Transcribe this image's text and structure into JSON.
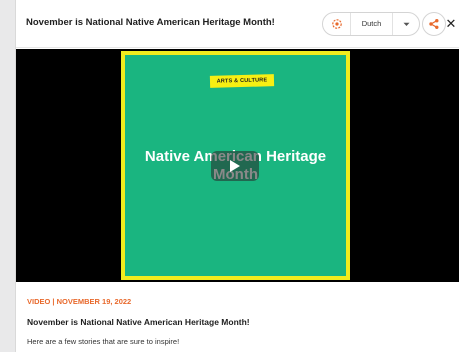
{
  "header": {
    "title": "November is National Native American Heritage Month!",
    "language": "Dutch",
    "translate_icon": "translate-icon",
    "caret_icon": "chevron-down-icon",
    "share_icon": "share-icon",
    "close_label": "✕"
  },
  "video": {
    "tag": "ARTS & CULTURE",
    "thumbnail_title": "Native American Heritage Month",
    "play_icon": "play-icon",
    "colors": {
      "thumbnail_bg": "#1ab580",
      "border": "#f2ec1d",
      "tag_bg": "#f7ef13"
    }
  },
  "story": {
    "meta": "VIDEO | NOVEMBER 19, 2022",
    "title": "November is National Native American Heritage Month!",
    "description": "Here are a few stories that are sure to inspire!"
  },
  "colors": {
    "accent": "#e8692c"
  }
}
